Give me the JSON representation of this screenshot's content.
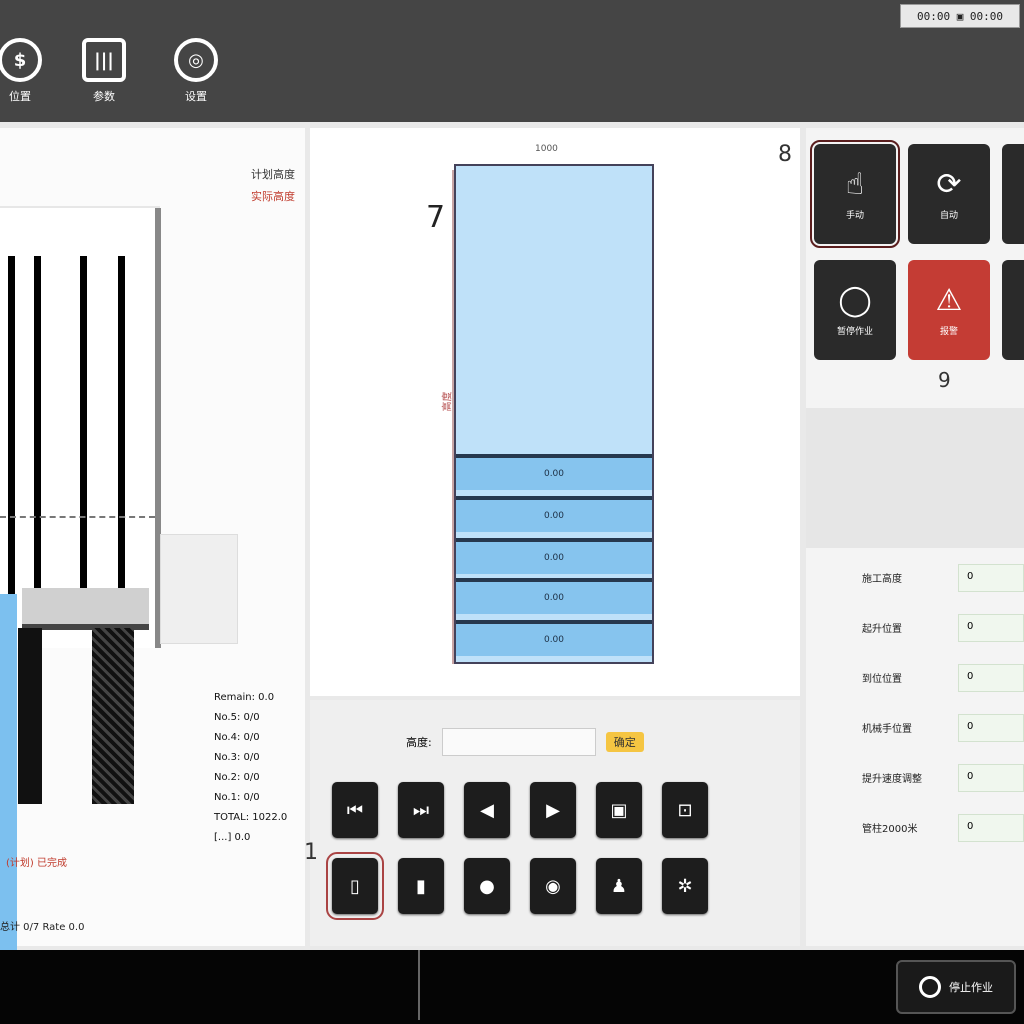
{
  "header": {
    "buttons": [
      {
        "icon": "camera-icon",
        "glyph": "$",
        "label": "位置"
      },
      {
        "icon": "sliders-icon",
        "glyph": "|||",
        "label": "参数"
      },
      {
        "icon": "settings-icon",
        "glyph": "◎",
        "label": "设置"
      }
    ],
    "status_text": "00:00 ▣ 00:00"
  },
  "left_panel": {
    "legend": [
      "计划高度",
      "实际高度"
    ],
    "readout_lines": [
      "Remain: 0.0",
      "No.5: 0/0",
      "No.4: 0/0",
      "No.3: 0/0",
      "No.2: 0/0",
      "No.1: 0/0",
      "TOTAL: 1022.0",
      "[...] 0.0"
    ],
    "tag": "(计划) 已完成",
    "footer": "总计 0/7  Rate 0.0"
  },
  "center_panel": {
    "column_label": "1000",
    "callout_7": "7",
    "vertical_label": "高度",
    "segments": [
      "0.00",
      "0.00",
      "0.00",
      "0.00",
      "0.00"
    ]
  },
  "controls": {
    "input_label": "高度:",
    "input_value": "",
    "confirm_label": "确定",
    "callout_1": "1",
    "buttons_row1": [
      {
        "name": "skip-first-icon",
        "glyph": "⏮"
      },
      {
        "name": "skip-last-icon",
        "glyph": "⏭"
      },
      {
        "name": "prev-icon",
        "glyph": "◀"
      },
      {
        "name": "next-icon",
        "glyph": "▶"
      },
      {
        "name": "square-icon",
        "glyph": "▣"
      },
      {
        "name": "frame-icon",
        "glyph": "⊡"
      }
    ],
    "buttons_row2": [
      {
        "name": "file-icon",
        "glyph": "▯"
      },
      {
        "name": "document-icon",
        "glyph": "▮"
      },
      {
        "name": "circle-icon",
        "glyph": "●"
      },
      {
        "name": "target-icon",
        "glyph": "◉"
      },
      {
        "name": "user-icon",
        "glyph": "♟"
      },
      {
        "name": "gear-icon",
        "glyph": "✲"
      }
    ]
  },
  "right_panel": {
    "callout_8": "8",
    "callout_9": "9",
    "tiles": [
      {
        "name": "hand-icon",
        "glyph": "☝",
        "caption": "手动"
      },
      {
        "name": "refresh-icon",
        "glyph": "⟳",
        "caption": "自动"
      },
      {
        "name": "stop-icon",
        "glyph": "◯",
        "caption": "暂停作业"
      },
      {
        "name": "alarm-icon",
        "glyph": "⚠",
        "caption": "报警"
      }
    ],
    "fields": [
      {
        "label": "施工高度",
        "value": "0"
      },
      {
        "label": "起升位置",
        "value": "0"
      },
      {
        "label": "到位位置",
        "value": "0"
      },
      {
        "label": "机械手位置",
        "value": "0"
      },
      {
        "label": "提升速度调整",
        "value": "0"
      },
      {
        "label": "管柱2000米",
        "value": "0"
      }
    ]
  },
  "footer_bar": {
    "button_label": "停止作业"
  }
}
